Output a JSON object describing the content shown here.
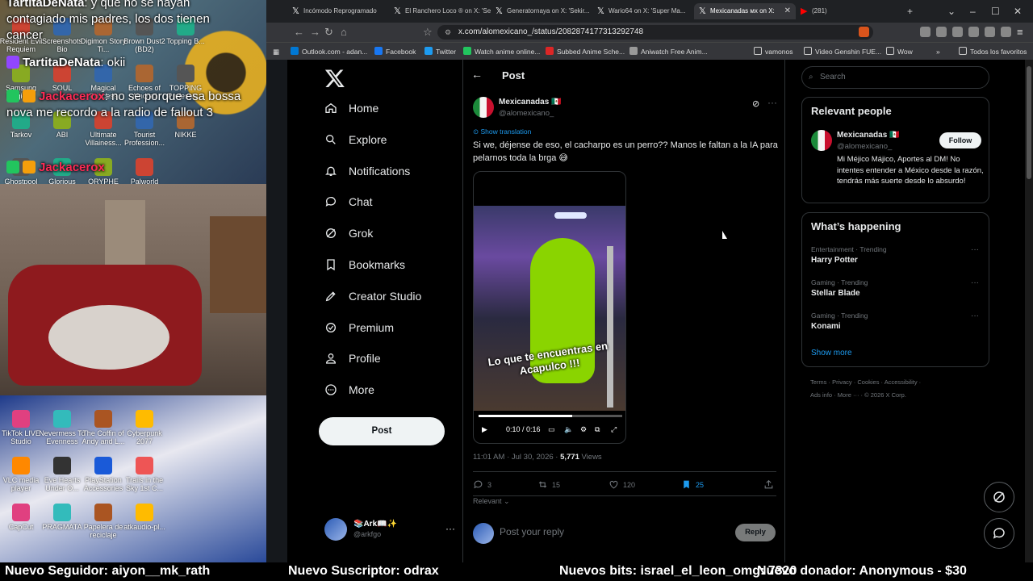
{
  "stream": {
    "chat": [
      {
        "user": "TartitaDeNata",
        "text": ": y que no se hayan contagiado mis padres, los dos tienen cancer",
        "color": "#ffffff"
      },
      {
        "user": "TartitaDeNata",
        "text": ": okii",
        "color": "#ffffff"
      },
      {
        "user": "Jackacerox",
        "text": ": no se porque esa bossa nova me recordo a la radio de fallout 3",
        "color": "#ff2a55"
      },
      {
        "user": "Jackacerox",
        "text": "",
        "color": "#ff2a55"
      }
    ],
    "desktop_icons_top": [
      "Resident Evil Requiem",
      "Screenshots Bio",
      "Digimon Story Ti...",
      "Brown Dust2 (BD2)",
      "Topping B...",
      "Samsung Magician",
      "SOUL",
      "Magical Princess",
      "Echoes of Aincrad",
      "TOPPING Professio...",
      "Tarkov",
      "ABI",
      "Ultimate Villainess...",
      "Tourist Profession...",
      "NIKKE",
      "Ghostpool",
      "Glorious",
      "ORYPHE",
      "Palworld"
    ],
    "desktop_icons_bottom": [
      "TikTok LIVE Studio",
      "Nevermess To Evenness",
      "The Coffin of Andy and L...",
      "Cyberpunk 2077",
      "VLC media player",
      "Eve Hearts Under O...",
      "PlayStation Accessories",
      "Trails in the Sky 1st C...",
      "CapCut",
      "PRAGMATA",
      "Papelera de reciclaje",
      "atkaudio-pl..."
    ],
    "ticker": {
      "follower": "Nuevo Seguidor: aiyon__mk_rath",
      "subscriber": "Nuevo Suscriptor: odrax",
      "bits": "Nuevos bits: israel_el_leon_omg: 7320",
      "donation": "Nuevo donador: Anonymous - $30"
    }
  },
  "browser": {
    "tabs": [
      {
        "title": "Incómodo Reprogramado",
        "active": false
      },
      {
        "title": "El Ranchero Loco ® on X: 'Sekir...",
        "active": false
      },
      {
        "title": "Generatornaya on X: 'Sekir...",
        "active": false
      },
      {
        "title": "Wario64 on X: 'Super Ma...",
        "active": false
      },
      {
        "title": "Mexicanadas мx on X:",
        "active": true
      },
      {
        "title": "(281)",
        "active": false
      }
    ],
    "url": "x.com/alomexicano_/status/2082874177313292748",
    "bookmarks": [
      {
        "label": "Outlook.com - adan...",
        "color": "#0078d4"
      },
      {
        "label": "Facebook",
        "color": "#1877f2"
      },
      {
        "label": "Twitter",
        "color": "#1d9bf0"
      },
      {
        "label": "Watch anime online...",
        "color": "#22c55e"
      },
      {
        "label": "Subbed Anime Sche...",
        "color": "#dc2626"
      },
      {
        "label": "Aniwatch Free Anim...",
        "color": "#999999"
      },
      {
        "label": "vamonos",
        "color": "#888888"
      },
      {
        "label": "Video Genshin FUE...",
        "color": "#888888"
      },
      {
        "label": "Wow",
        "color": "#888888"
      },
      {
        "label": "Todos los favoritos",
        "color": "#888888"
      }
    ]
  },
  "x": {
    "nav": [
      {
        "key": "home",
        "label": "Home"
      },
      {
        "key": "explore",
        "label": "Explore"
      },
      {
        "key": "notifications",
        "label": "Notifications"
      },
      {
        "key": "chat",
        "label": "Chat"
      },
      {
        "key": "grok",
        "label": "Grok"
      },
      {
        "key": "bookmarks",
        "label": "Bookmarks"
      },
      {
        "key": "creator",
        "label": "Creator Studio"
      },
      {
        "key": "premium",
        "label": "Premium"
      },
      {
        "key": "profile",
        "label": "Profile"
      },
      {
        "key": "more",
        "label": "More"
      }
    ],
    "post_button": "Post",
    "me": {
      "name": "📚Ark📖✨",
      "handle": "@arkfgo"
    },
    "header_title": "Post",
    "post": {
      "author_name": "Mexicanadas",
      "author_handle": "@alomexicano_",
      "show_translation": "Show translation",
      "text": "Si we, déjense de eso, el cacharpo es un perro?? Manos le faltan a la IA para pelarnos toda la brga 😅",
      "video_caption": "Lo que te encuentras en Acapulco !!!",
      "video_time": "0:10 / 0:16",
      "video_progress": 0.65,
      "timestamp": "11:01 AM · Jul 30, 2026",
      "views_count": "5,771",
      "views_label": "Views",
      "replies": "3",
      "reposts": "15",
      "likes": "120",
      "bookmarks": "25",
      "sort_label": "Relevant",
      "reply_placeholder": "Post your reply",
      "reply_button": "Reply"
    },
    "search_placeholder": "Search",
    "relevant_people": {
      "title": "Relevant people",
      "name": "Mexicanadas",
      "handle": "@alomexicano_",
      "follow": "Follow",
      "bio": "Mi Méjico Májico, Aportes al DM! No intentes entender a México desde la razón, tendrás más suerte desde lo absurdo!"
    },
    "happening": {
      "title": "What’s happening",
      "trends": [
        {
          "meta": "Entertainment · Trending",
          "name": "Harry Potter"
        },
        {
          "meta": "Gaming · Trending",
          "name": "Stellar Blade"
        },
        {
          "meta": "Gaming · Trending",
          "name": "Konami"
        }
      ],
      "show_more": "Show more"
    },
    "footer": [
      "Terms",
      "Privacy",
      "Cookies",
      "Accessibility",
      "Ads info",
      "More ···",
      "© 2026 X Corp."
    ]
  }
}
